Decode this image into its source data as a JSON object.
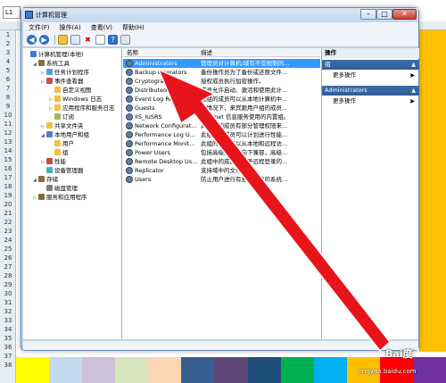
{
  "spreadsheet": {
    "name_box": "L1",
    "row_numbers": [
      "1",
      "2",
      "3",
      "4",
      "5",
      "6",
      "7",
      "8",
      "9",
      "10",
      "11",
      "12",
      "13",
      "14",
      "15",
      "16",
      "17",
      "18",
      "19",
      "20",
      "21",
      "22",
      "23",
      "24",
      "25",
      "26",
      "27",
      "28",
      "29",
      "30",
      "31",
      "32",
      "33",
      "34",
      "35",
      "36",
      "37",
      "38"
    ],
    "strip_colors": [
      "#ffff00",
      "#c5d9f1",
      "#ccc0da",
      "#d8e4bc",
      "#fcd5b4",
      "#366092",
      "#60497a",
      "#1f4e79",
      "#00b050",
      "#00b0f0",
      "#ffc000",
      "#ff0000",
      "#7030a0"
    ]
  },
  "window": {
    "title": "计算机管理",
    "minimize": "–",
    "maximize": "□",
    "close": "✕"
  },
  "menu": [
    "文件(F)",
    "操作(A)",
    "查看(V)",
    "帮助(H)"
  ],
  "toolbar_icons": [
    "back-icon",
    "forward-icon",
    "up-folder-icon",
    "show-tree-icon",
    "delete-icon",
    "properties-icon",
    "help-icon",
    "mmc-icon"
  ],
  "tree": [
    {
      "label": "计算机管理(本地)",
      "level": 0,
      "expander": "",
      "icon_color": "#3a7bd5"
    },
    {
      "label": "系统工具",
      "level": 1,
      "expander": "◢",
      "icon_color": "#8a6d3b"
    },
    {
      "label": "任务计划程序",
      "level": 2,
      "expander": "▷",
      "icon_color": "#5b9bd5"
    },
    {
      "label": "事件查看器",
      "level": 2,
      "expander": "▷",
      "icon_color": "#c0504d"
    },
    {
      "label": "自定义视图",
      "level": 3,
      "expander": "",
      "icon_color": "#f0c040"
    },
    {
      "label": "Windows 日志",
      "level": 3,
      "expander": "▷",
      "icon_color": "#f0c040"
    },
    {
      "label": "应用程序和服务日志",
      "level": 3,
      "expander": "▷",
      "icon_color": "#f0c040"
    },
    {
      "label": "订阅",
      "level": 3,
      "expander": "",
      "icon_color": "#9bbb59"
    },
    {
      "label": "共享文件夹",
      "level": 2,
      "expander": "▷",
      "icon_color": "#f0c040"
    },
    {
      "label": "本地用户和组",
      "level": 2,
      "expander": "◢",
      "icon_color": "#4f81bd"
    },
    {
      "label": "用户",
      "level": 3,
      "expander": "",
      "icon_color": "#f0c040"
    },
    {
      "label": "组",
      "level": 3,
      "expander": "",
      "icon_color": "#f0c040"
    },
    {
      "label": "性能",
      "level": 2,
      "expander": "▷",
      "icon_color": "#c0504d"
    },
    {
      "label": "设备管理器",
      "level": 2,
      "expander": "",
      "icon_color": "#4bacc6"
    },
    {
      "label": "存储",
      "level": 1,
      "expander": "◢",
      "icon_color": "#8a6d3b"
    },
    {
      "label": "磁盘管理",
      "level": 2,
      "expander": "",
      "icon_color": "#7f7f7f"
    },
    {
      "label": "服务和应用程序",
      "level": 1,
      "expander": "▷",
      "icon_color": "#8a6d3b"
    }
  ],
  "list": {
    "col_name": "名称",
    "col_desc": "描述",
    "rows": [
      {
        "name": "Administrators",
        "desc": "管理员对计算机/域有不受限制的...",
        "selected": true
      },
      {
        "name": "Backup Operators",
        "desc": "备份操作员为了备份或还原文件...",
        "selected": false
      },
      {
        "name": "Cryptographic",
        "desc": "授权成员执行加密操作。",
        "selected": false
      },
      {
        "name": "Distributed CO",
        "desc": "成员允许启动、激活和使用此计...",
        "selected": false
      },
      {
        "name": "Event Log Readers",
        "desc": "此组的成员可以从本地计算机中...",
        "selected": false
      },
      {
        "name": "Guests",
        "desc": "认情况下，来宾跟用户组的成员...",
        "selected": false
      },
      {
        "name": "IIS_IUSRS",
        "desc": "Internet 信息服务使用的内置组。",
        "selected": false
      },
      {
        "name": "Network Configurat...",
        "desc": "此组中的成员有部分管理权限来...",
        "selected": false
      },
      {
        "name": "Performance Log U...",
        "desc": "此组中的成员可以计划进行性能...",
        "selected": false
      },
      {
        "name": "Performance Monit...",
        "desc": "此组的成员可以从本地和远程访...",
        "selected": false
      },
      {
        "name": "Power Users",
        "desc": "包括高级用户以向下兼容，高级...",
        "selected": false
      },
      {
        "name": "Remote Desktop Us...",
        "desc": "此组中的成员被授予远程登录的...",
        "selected": false
      },
      {
        "name": "Replicator",
        "desc": "支持域中的文件复制",
        "selected": false
      },
      {
        "name": "Users",
        "desc": "防止用户进行有意或无意的系统...",
        "selected": false
      }
    ]
  },
  "actions": {
    "header": "操作",
    "group1": "组",
    "group1_item": "更多操作",
    "group2": "Administrators",
    "group2_item": "更多操作"
  },
  "watermark": {
    "line1": "Bai度",
    "line2": "jingyan.baidu.com"
  },
  "arrow_color": "#e8141c"
}
